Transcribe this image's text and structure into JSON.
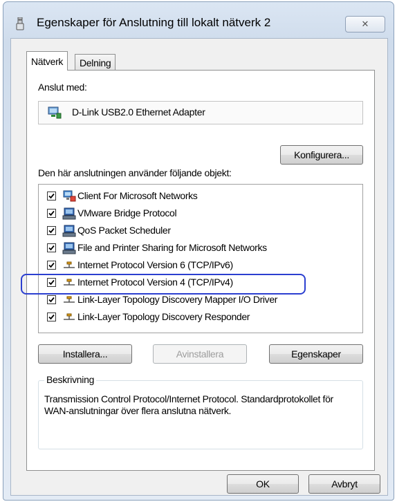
{
  "window": {
    "title": "Egenskaper för Anslutning till lokalt nätverk 2",
    "close_glyph": "✕"
  },
  "tabs": [
    {
      "label": "Nätverk",
      "selected": true
    },
    {
      "label": "Delning",
      "selected": false
    }
  ],
  "connect_using": {
    "label": "Anslut med:",
    "adapter": "D-Link USB2.0 Ethernet Adapter",
    "configure_button": "Konfigurera..."
  },
  "items_section": {
    "label": "Den här anslutningen använder följande objekt:",
    "items": [
      {
        "label": "Client For Microsoft Networks",
        "checked": true,
        "icon": "network-client-icon"
      },
      {
        "label": "VMware Bridge Protocol",
        "checked": true,
        "icon": "network-service-icon"
      },
      {
        "label": "QoS Packet Scheduler",
        "checked": true,
        "icon": "network-service-icon"
      },
      {
        "label": "File and Printer Sharing for Microsoft Networks",
        "checked": true,
        "icon": "network-service-icon"
      },
      {
        "label": "Internet Protocol Version 6 (TCP/IPv6)",
        "checked": true,
        "icon": "protocol-icon"
      },
      {
        "label": "Internet Protocol Version 4 (TCP/IPv4)",
        "checked": true,
        "icon": "protocol-icon",
        "highlighted": true
      },
      {
        "label": "Link-Layer Topology Discovery Mapper I/O Driver",
        "checked": true,
        "icon": "protocol-icon"
      },
      {
        "label": "Link-Layer Topology Discovery Responder",
        "checked": true,
        "icon": "protocol-icon"
      }
    ]
  },
  "actions": {
    "install": "Installera...",
    "uninstall": "Avinstallera",
    "properties": "Egenskaper"
  },
  "description": {
    "legend": "Beskrivning",
    "text": "Transmission Control Protocol/Internet Protocol. Standardprotokollet för WAN-anslutningar över flera anslutna nätverk."
  },
  "footer": {
    "ok": "OK",
    "cancel": "Avbryt"
  },
  "colors": {
    "highlight_outline": "#2b3fd0"
  }
}
